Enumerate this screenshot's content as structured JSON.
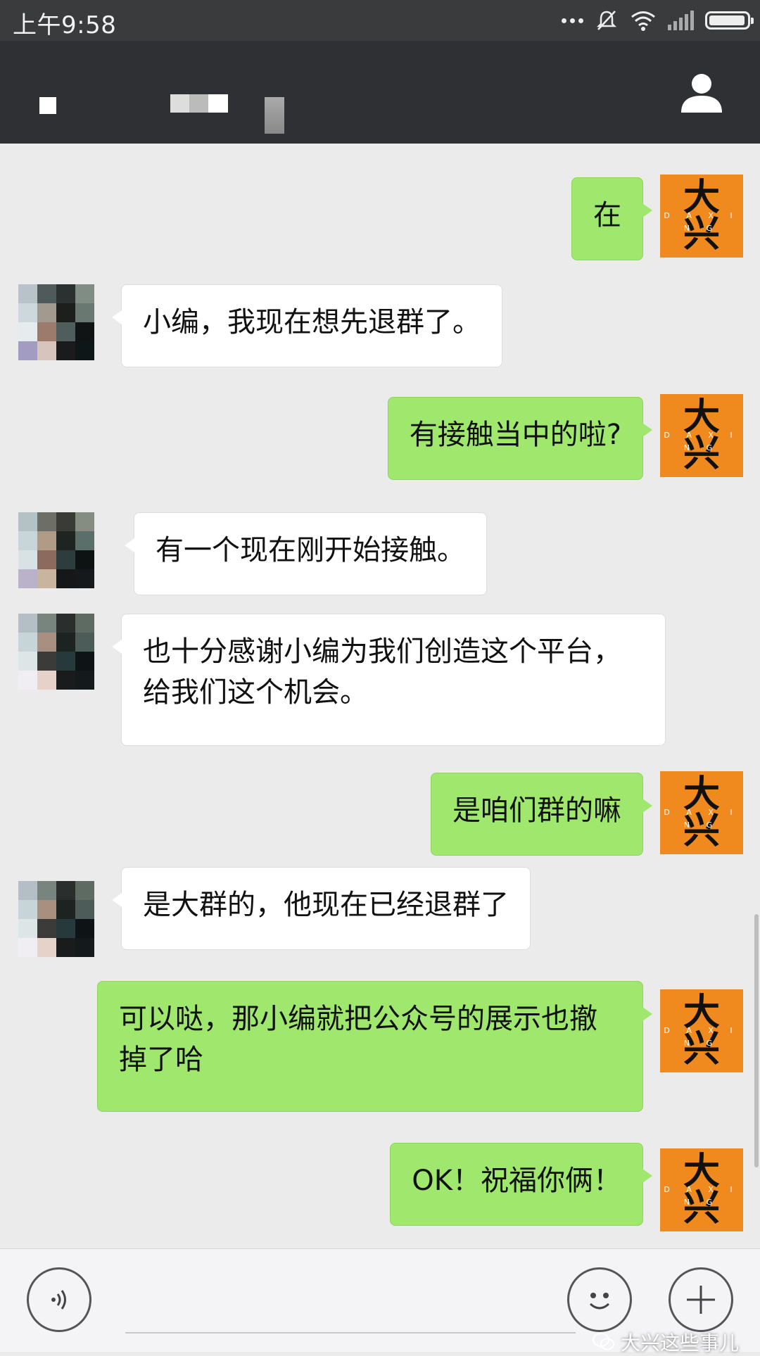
{
  "status_bar": {
    "time": "上午9:58"
  },
  "header": {
    "contact_name_hidden": true
  },
  "messages": [
    {
      "side": "me",
      "text": "在"
    },
    {
      "side": "them",
      "text": "小编，我现在想先退群了。"
    },
    {
      "side": "me",
      "text": "有接触当中的啦?"
    },
    {
      "side": "them",
      "text": "有一个现在刚开始接触。"
    },
    {
      "side": "them",
      "text": "也十分感谢小编为我们创造这个平台，给我们这个机会。"
    },
    {
      "side": "me",
      "text": "是咱们群的嘛"
    },
    {
      "side": "them",
      "text": "是大群的，他现在已经退群了"
    },
    {
      "side": "me",
      "text": "可以哒，那小编就把公众号的展示也撤掉了哈"
    },
    {
      "side": "me",
      "text": "OK！祝福你俩！"
    }
  ],
  "my_avatar": {
    "top": "大",
    "bottom": "兴",
    "band": "D A X I N G",
    "color": "#f08a1e"
  },
  "watermark": {
    "text": "大兴这些事儿"
  },
  "icons": {
    "voice": "voice-icon",
    "emoji": "emoji-icon",
    "plus": "plus-icon",
    "profile": "person-icon"
  },
  "colors": {
    "my_bubble": "#9fe86d",
    "their_bubble": "#ffffff",
    "header": "#2f3033"
  }
}
